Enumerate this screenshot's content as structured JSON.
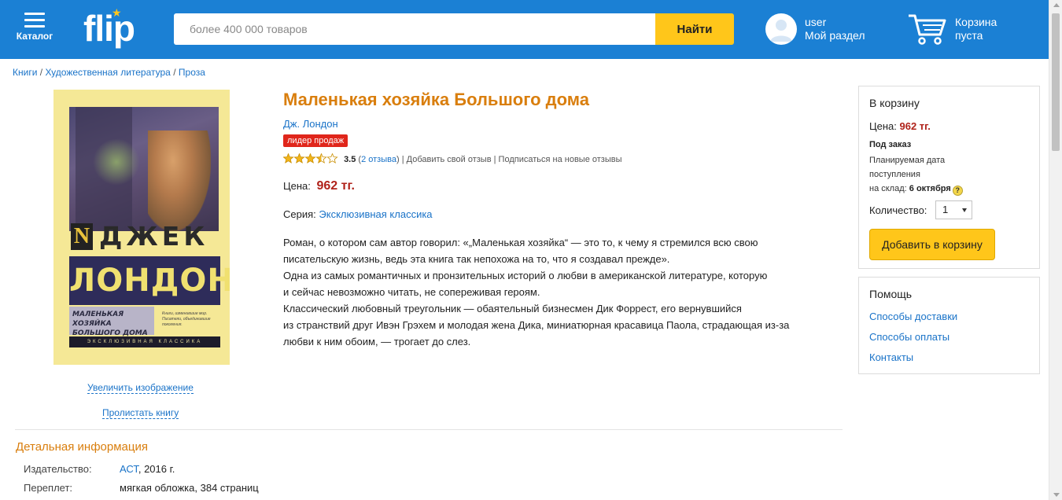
{
  "header": {
    "catalog_label": "Каталог",
    "logo_text": "flip",
    "search": {
      "placeholder": "более 400 000 товаров",
      "button_label": "Найти"
    },
    "user": {
      "name": "user",
      "section": "Мой раздел"
    },
    "cart": {
      "label": "Корзина",
      "status": "пуста"
    },
    "colors": {
      "header_bg": "#1b80d4",
      "accent": "#ffc61a"
    }
  },
  "breadcrumb": {
    "items": [
      "Книги",
      "Художественная литература",
      "Проза"
    ],
    "separator": "/"
  },
  "cover": {
    "author_initial": "N",
    "author_first": "ДЖЕК",
    "author_last": "ЛОНДОН",
    "book_title": "МАЛЕНЬКАЯ ХОЗЯЙКА БОЛЬШОГО ДОМА",
    "tagline": "Книги, изменившие мир. Писатели, объединившие поколения.",
    "series": "ЭКСКЛЮЗИВНАЯ КЛАССИКА",
    "enlarge_link": "Увеличить изображение",
    "flip_link": "Пролистать книгу"
  },
  "product": {
    "title": "Маленькая хозяйка Большого дома",
    "author": "Дж. Лондон",
    "badge": "лидер продаж",
    "rating": {
      "value": "3.5",
      "stars": 3.5,
      "reviews_link": "2 отзыва",
      "add_review": "Добавить свой отзыв",
      "subscribe": "Подписаться на новые отзывы"
    },
    "price_label": "Цена:",
    "price": "962 тг.",
    "series_label": "Серия:",
    "series": "Эксклюзивная классика",
    "description": [
      "Роман, о котором сам автор говорил: «„Маленькая хозяйка“ — это то, к чему я стремился всю свою",
      "писательскую жизнь, ведь эта книга так непохожа на то, что я создавал прежде».",
      "Одна из самых романтичных и пронзительных историй о любви в американской литературе, которую",
      "и сейчас невозможно читать, не сопереживая героям.",
      "Классический любовный треугольник — обаятельный бизнесмен Дик Форрест, его вернувшийся",
      "из странствий друг Ивэн Грэхем и молодая жена Дика, миниатюрная красавица Паола, страдающая из-за",
      "любви к ним обоим, — трогает до слез."
    ]
  },
  "details": {
    "title": "Детальная информация",
    "rows": [
      {
        "key": "Издательство:",
        "link": "АСТ",
        "value": ", 2016 г."
      },
      {
        "key": "Переплет:",
        "value": "мягкая обложка, 384 страниц"
      }
    ]
  },
  "buy_panel": {
    "title": "В корзину",
    "price_label": "Цена:",
    "price": "962 тг.",
    "order_label": "Под заказ",
    "order_text_1": "Планируемая дата",
    "order_text_2": "поступления",
    "order_text_3": "на склад:",
    "order_date": "6 октября",
    "help_icon": "?",
    "qty_label": "Количество:",
    "qty_value": "1",
    "add_button": "Добавить в корзину"
  },
  "help_panel": {
    "title": "Помощь",
    "links": [
      "Способы доставки",
      "Способы оплаты",
      "Контакты"
    ]
  }
}
